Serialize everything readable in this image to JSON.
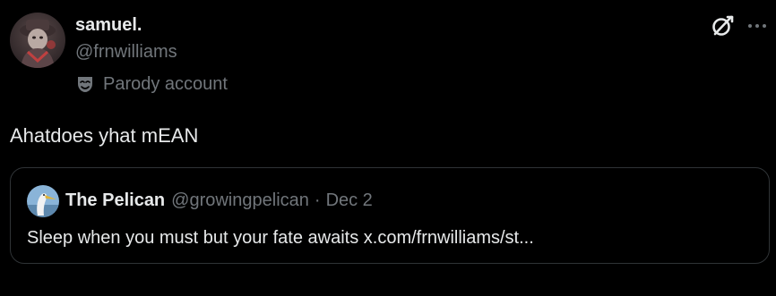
{
  "author": {
    "name": "samuel.",
    "handle": "@frnwilliams",
    "label": "Parody account"
  },
  "tweet": {
    "text": "Ahatdoes yhat mEAN"
  },
  "quote": {
    "name": "The Pelican",
    "handle": "@growingpelican",
    "separator": "·",
    "date": "Dec 2",
    "text": "Sleep when you must but your fate awaits x.com/frnwilliams/st..."
  },
  "icons": {
    "grok": "grok-icon",
    "more": "more-icon",
    "parody": "parody-mask-icon"
  },
  "colors": {
    "background": "#000000",
    "primary_text": "#e7e9ea",
    "secondary_text": "#71767b",
    "border": "#2f3336"
  }
}
